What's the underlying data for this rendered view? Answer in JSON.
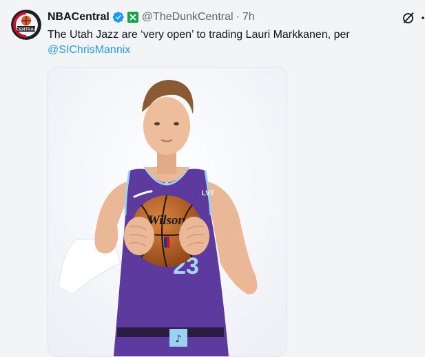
{
  "tweet": {
    "display_name": "NBACentral",
    "handle": "@TheDunkCentral",
    "separator": "·",
    "time": "7h",
    "text_before": "The Utah Jazz are ‘very open’ to trading Lauri Markkanen, per",
    "mention": "@SIChrisMannix",
    "icons": {
      "verified": "verified-badge-icon",
      "affiliate": "affiliate-x-badge-icon",
      "grok": "grok-icon",
      "more": "more-icon"
    }
  },
  "avatar": {
    "logo_text": "CENTRAL"
  },
  "media": {
    "ball_brand": "Wilson",
    "jersey_logo": "LVT",
    "jersey_number": "23"
  },
  "colors": {
    "accent": "#1d9bf0",
    "verified": "#1d9bf0",
    "affiliate": "#16a34a",
    "jersey": "#5c3a9e",
    "text": "#0f1419",
    "muted": "#536471"
  }
}
